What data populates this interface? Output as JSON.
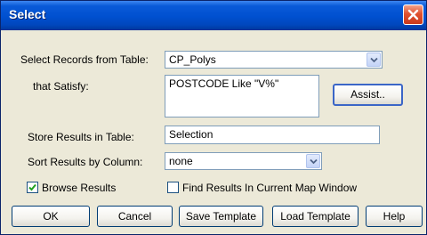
{
  "window": {
    "title": "Select"
  },
  "form": {
    "select_from_label": "Select Records from Table:",
    "select_from_value": "CP_Polys",
    "satisfy_label": "that Satisfy:",
    "expression": "POSTCODE Like \"V%\"",
    "assist_label": "Assist..",
    "store_label": "Store Results in Table:",
    "store_value": "Selection",
    "sort_label": "Sort Results by Column:",
    "sort_value": "none",
    "browse_label": "Browse Results",
    "browse_checked": true,
    "find_label": "Find Results In Current Map Window",
    "find_checked": false
  },
  "buttons": {
    "ok": "OK",
    "cancel": "Cancel",
    "save_template": "Save Template",
    "load_template": "Load Template",
    "help": "Help"
  },
  "colors": {
    "titlebar": "#0050d0",
    "dialog_bg": "#ece9d8",
    "close_button": "#e0512f"
  },
  "icons": {
    "close": "close-icon",
    "dropdown": "chevron-down-icon",
    "check": "checkmark-icon"
  }
}
